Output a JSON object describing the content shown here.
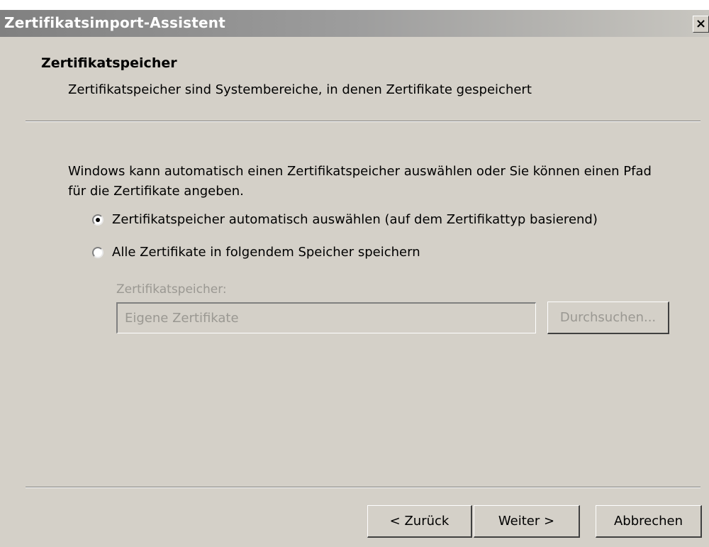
{
  "window": {
    "title": "Zertifikatsimport-Assistent",
    "close_glyph": "×"
  },
  "header": {
    "title": "Zertifikatspeicher",
    "subtitle": "Zertifikatspeicher sind Systembereiche, in denen Zertifikate gespeichert"
  },
  "content": {
    "description": "Windows kann automatisch einen Zertifikatspeicher auswählen oder Sie können einen Pfad für die Zertifikate angeben.",
    "options": [
      {
        "label": "Zertifikatspeicher automatisch auswählen (auf dem Zertifikattyp basierend)",
        "selected": true
      },
      {
        "label": "Alle Zertifikate in folgendem Speicher speichern",
        "selected": false
      }
    ],
    "store_label": "Zertifikatspeicher:",
    "store_value": "Eigene Zertifikate",
    "browse_label": "Durchsuchen..."
  },
  "footer": {
    "back_label": "< Zurück",
    "next_label": "Weiter >",
    "cancel_label": "Abbrechen"
  },
  "colors": {
    "dialog_bg": "#d4d0c8",
    "title_gradient_start": "#808080",
    "disabled_text": "#9a9892"
  }
}
